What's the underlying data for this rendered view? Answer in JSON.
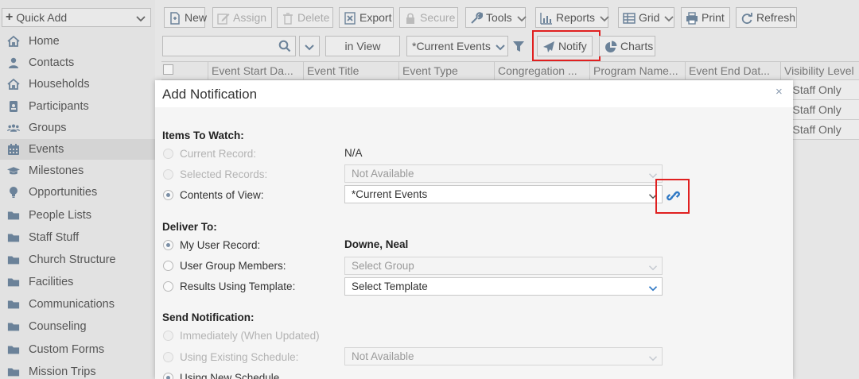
{
  "sidebar": {
    "quick_add": "Quick Add",
    "items": [
      {
        "label": "Home"
      },
      {
        "label": "Contacts"
      },
      {
        "label": "Households"
      },
      {
        "label": "Participants"
      },
      {
        "label": "Groups"
      },
      {
        "label": "Events"
      },
      {
        "label": "Milestones"
      },
      {
        "label": "Opportunities"
      },
      {
        "label": "People Lists"
      },
      {
        "label": "Staff Stuff"
      },
      {
        "label": "Church Structure"
      },
      {
        "label": "Facilities"
      },
      {
        "label": "Communications"
      },
      {
        "label": "Counseling"
      },
      {
        "label": "Custom Forms"
      },
      {
        "label": "Mission Trips"
      }
    ]
  },
  "toolbar": {
    "new": "New",
    "assign": "Assign",
    "delete": "Delete",
    "export": "Export",
    "secure": "Secure",
    "tools": "Tools",
    "reports": "Reports",
    "grid": "Grid",
    "print": "Print",
    "refresh": "Refresh"
  },
  "view_bar": {
    "in_view": "in View",
    "view_select": "*Current Events",
    "notify": "Notify",
    "charts": "Charts"
  },
  "grid": {
    "columns": [
      "Event Start Da...",
      "Event Title",
      "Event Type",
      "Congregation ...",
      "Program Name...",
      "Event End Dat...",
      "Visibility Level"
    ],
    "visibility_cells": [
      "- Staff Only",
      "- Staff Only",
      "- Staff Only"
    ]
  },
  "modal": {
    "title": "Add Notification",
    "close": "×",
    "items_to_watch": {
      "heading": "Items To Watch:",
      "current_record_label": "Current Record:",
      "current_record_value": "N/A",
      "selected_records_label": "Selected Records:",
      "selected_records_value": "Not Available",
      "contents_of_view_label": "Contents of View:",
      "contents_of_view_value": "*Current Events"
    },
    "deliver_to": {
      "heading": "Deliver To:",
      "my_user_record_label": "My User Record:",
      "my_user_record_value": "Downe, Neal",
      "user_group_label": "User Group Members:",
      "user_group_value": "Select Group",
      "results_template_label": "Results Using Template:",
      "results_template_value": "Select Template"
    },
    "send_notification": {
      "heading": "Send Notification:",
      "immediately_label": "Immediately (When Updated)",
      "existing_schedule_label": "Using Existing Schedule:",
      "existing_schedule_value": "Not Available",
      "new_schedule_label": "Using New Schedule"
    }
  },
  "colors": {
    "highlight": "#e02020",
    "link_icon": "#2f78c4"
  }
}
